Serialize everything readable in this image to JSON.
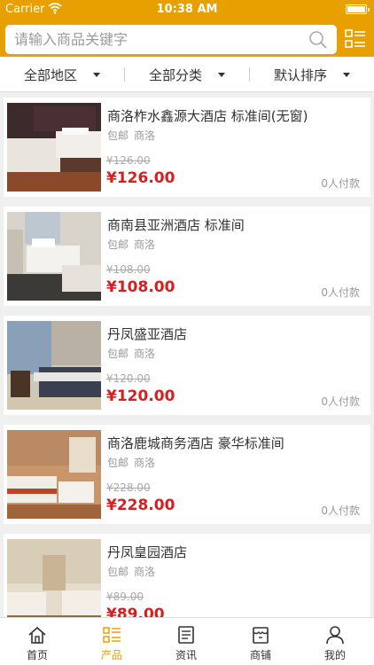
{
  "status_bar": {
    "carrier": "Carrier",
    "time": "10:38 AM"
  },
  "search": {
    "placeholder": "请输入商品关键字"
  },
  "filters": {
    "region": "全部地区",
    "category": "全部分类",
    "sort": "默认排序"
  },
  "products": [
    {
      "title": "商洛柞水鑫源大酒店 标准间(无窗)",
      "tag1": "包邮",
      "tag2": "商洛",
      "old_price": "¥126.00",
      "price": "¥126.00",
      "paid": "0人付款"
    },
    {
      "title": "商南县亚洲酒店 标准间",
      "tag1": "包邮",
      "tag2": "商洛",
      "old_price": "¥108.00",
      "price": "¥108.00",
      "paid": "0人付款"
    },
    {
      "title": "丹凤盛亚酒店",
      "tag1": "包邮",
      "tag2": "商洛",
      "old_price": "¥120.00",
      "price": "¥120.00",
      "paid": "0人付款"
    },
    {
      "title": "商洛鹿城商务酒店 豪华标准间",
      "tag1": "包邮",
      "tag2": "商洛",
      "old_price": "¥228.00",
      "price": "¥228.00",
      "paid": "0人付款"
    },
    {
      "title": "丹凤皇园酒店",
      "tag1": "包邮",
      "tag2": "商洛",
      "old_price": "¥89.00",
      "price": "¥89.00",
      "paid": ""
    }
  ],
  "tabbar": {
    "home": "首页",
    "products": "产品",
    "news": "资讯",
    "shops": "商铺",
    "mine": "我的"
  },
  "colors": {
    "accent": "#e8a000",
    "price": "#d81e1e"
  },
  "icons": [
    "wifi-icon",
    "battery-icon",
    "search-icon",
    "menu-list-icon",
    "home-icon",
    "product-list-icon",
    "news-icon",
    "shop-icon",
    "user-icon"
  ]
}
